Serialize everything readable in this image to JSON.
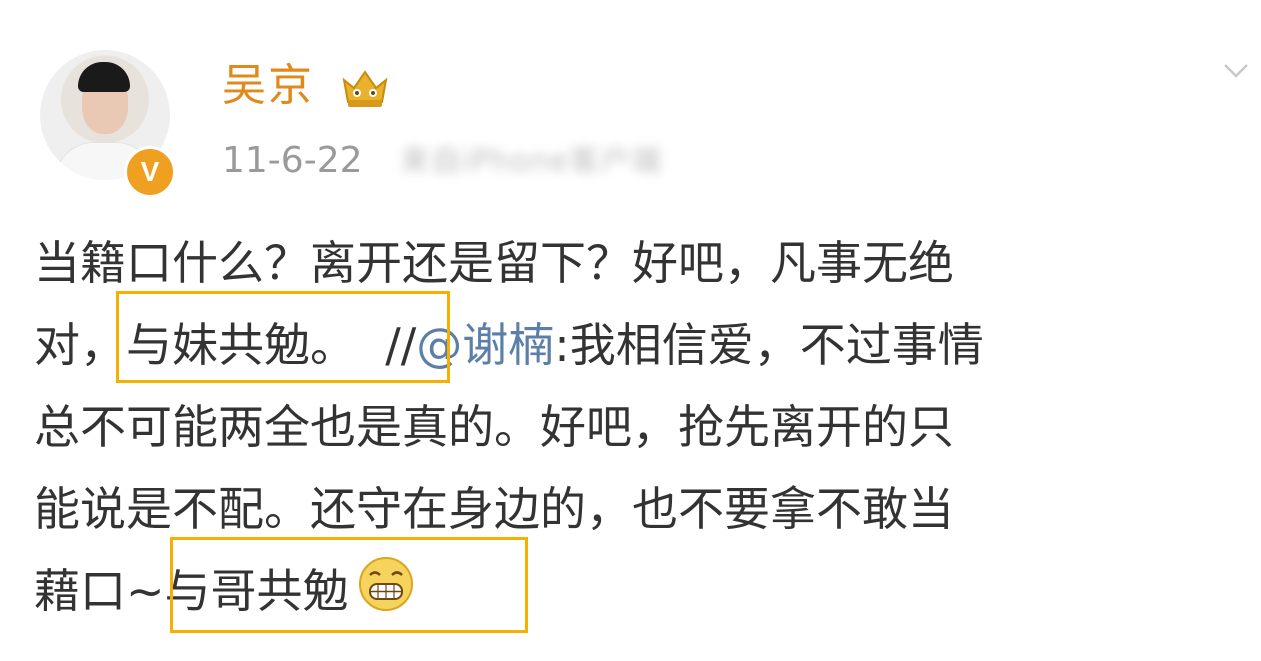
{
  "post": {
    "author": {
      "name": "吴京",
      "verified_badge": "V",
      "vip_icon": "crown-vip-icon"
    },
    "timestamp": "11-6-22",
    "source_blurred": "来自iPhone客户端",
    "content": {
      "line1": "当籍口什么？离开还是留下？好吧，凡事无绝",
      "line2_pre": "对，",
      "line2_highlight": "与妹共勉。",
      "line2_repost_prefix": "//",
      "line2_mention": "@谢楠",
      "line2_post": ":我相信爱，不过事情",
      "line3": "总不可能两全也是真的。好吧，抢先离开的只",
      "line4": "能说是不配。还守在身边的，也不要拿不敢当",
      "line5_pre": "藉口",
      "line5_tilde": "~",
      "line5_highlight": "与哥共勉",
      "emoji": "grin-emoji"
    },
    "colors": {
      "name": "#e08a1c",
      "mention": "#5b7fa8",
      "highlight_box": "#f5b000",
      "badge": "#f0a020"
    },
    "icons": {
      "expand": "chevron-down-icon"
    }
  }
}
